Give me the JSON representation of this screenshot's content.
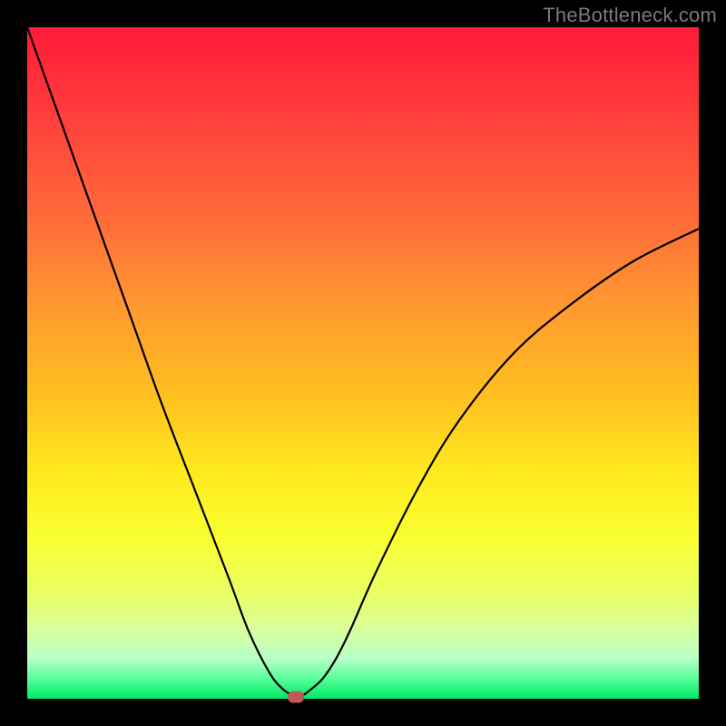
{
  "watermark": "TheBottleneck.com",
  "chart_data": {
    "type": "line",
    "title": "",
    "xlabel": "",
    "ylabel": "",
    "xlim": [
      0,
      100
    ],
    "ylim": [
      0,
      100
    ],
    "series": [
      {
        "name": "curve",
        "x": [
          0,
          5,
          10,
          15,
          20,
          25,
          30,
          33,
          36,
          38,
          40,
          41,
          42,
          44,
          46,
          48,
          52,
          58,
          64,
          72,
          80,
          90,
          100
        ],
        "y": [
          100,
          86,
          72,
          58,
          44,
          31,
          18,
          10,
          4,
          1.5,
          0.3,
          0.5,
          1.2,
          3,
          6,
          10,
          19,
          31,
          41,
          51,
          58,
          65,
          70
        ]
      }
    ],
    "minimum_marker": {
      "x": 40,
      "y": 0.3
    },
    "gradient_meaning": "background shades from red (top, high bottleneck) to green (bottom, zero bottleneck)"
  }
}
